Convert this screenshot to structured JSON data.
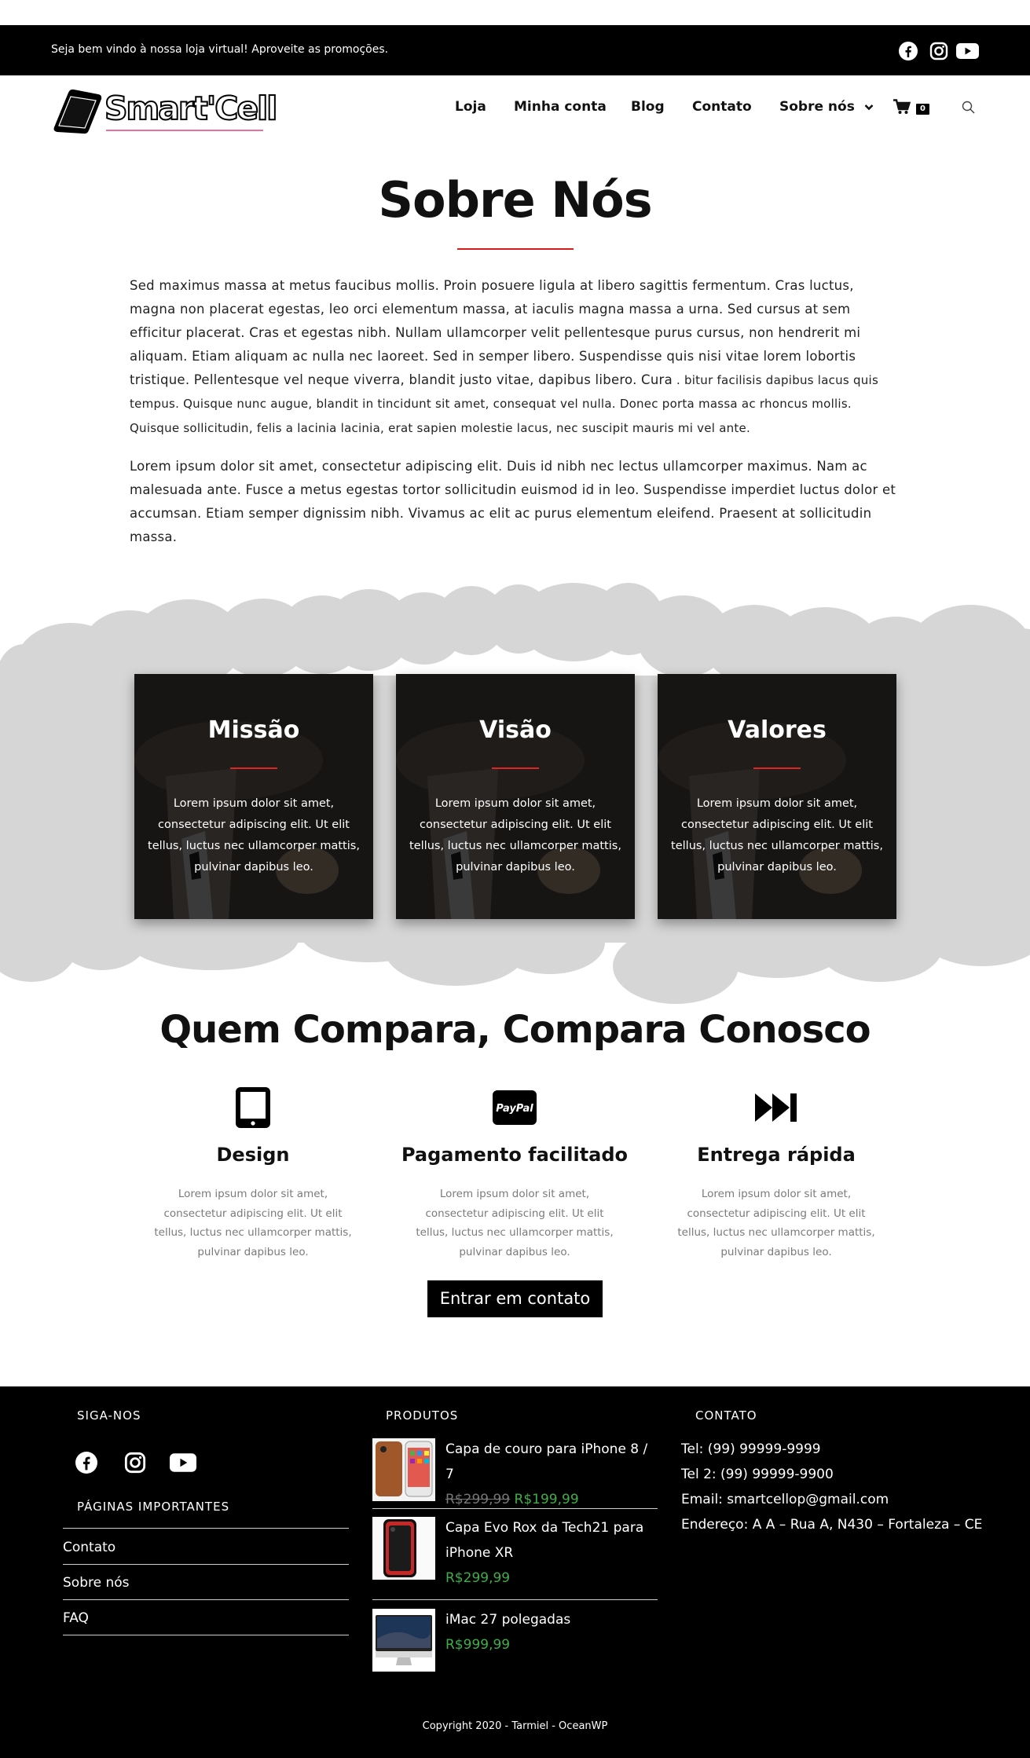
{
  "topbar": {
    "message": "Seja bem vindo à nossa loja virtual! Aproveite as promoções.",
    "social_icons": [
      "facebook-icon",
      "instagram-icon",
      "youtube-icon"
    ]
  },
  "header": {
    "logo_text": "Smart'Cell",
    "nav": [
      "Loja",
      "Minha conta",
      "Blog",
      "Contato",
      "Sobre nós"
    ],
    "cart_count": "0"
  },
  "about": {
    "title": "Sobre Nós",
    "paragraph1": "Sed maximus massa at metus faucibus mollis. Proin posuere ligula at libero sagittis fermentum. Cras luctus, magna non placerat egestas, leo orci elementum massa, at iaculis magna massa a urna. Sed cursus at sem efficitur placerat. Cras et egestas nibh. Nullam ullamcorper velit pellentesque purus cursus, non hendrerit mi aliquam. Etiam aliquam ac nulla nec laoreet. Sed in semper libero. Suspendisse quis nisi vitae lorem lobortis tristique. Pellentesque vel neque viverra, blandit justo vitae, dapibus libero. Cura",
    "paragraph1_small": " . bitur facilisis dapibus lacus quis tempus. Quisque nunc augue, blandit in tincidunt sit amet, consequat vel nulla. Donec porta massa ac rhoncus mollis. Quisque sollicitudin, felis a lacinia lacinia, erat sapien molestie lacus, nec suscipit mauris mi vel ante.",
    "paragraph2": "Lorem ipsum dolor sit amet, consectetur adipiscing elit. Duis id nibh nec lectus ullamcorper maximus. Nam ac malesuada ante. Fusce a metus egestas tortor sollicitudin euismod id in leo. Suspendisse imperdiet luctus dolor et accumsan. Etiam semper dignissim nibh. Vivamus ac elit ac purus elementum eleifend. Praesent at sollicitudin massa."
  },
  "cards": [
    {
      "title": "Missão",
      "text": "Lorem ipsum dolor sit amet, consectetur adipiscing elit. Ut elit tellus, luctus nec ullamcorper mattis, pulvinar dapibus leo."
    },
    {
      "title": "Visão",
      "text": "Lorem ipsum dolor sit amet, consectetur adipiscing elit. Ut elit tellus, luctus nec ullamcorper mattis, pulvinar dapibus leo."
    },
    {
      "title": "Valores",
      "text": "Lorem ipsum dolor sit amet, consectetur adipiscing elit. Ut elit tellus, luctus nec ullamcorper mattis, pulvinar dapibus leo."
    }
  ],
  "compare": {
    "title": "Quem Compara, Compara Conosco",
    "features": [
      {
        "icon": "tablet-icon",
        "title": "Design",
        "text": "Lorem ipsum dolor sit amet, consectetur adipiscing elit. Ut elit tellus, luctus nec ullamcorper mattis, pulvinar dapibus leo."
      },
      {
        "icon": "paypal-icon",
        "icon_text": "PayPal",
        "title": "Pagamento facilitado",
        "text": "Lorem ipsum dolor sit amet, consectetur adipiscing elit. Ut elit tellus, luctus nec ullamcorper mattis, pulvinar dapibus leo."
      },
      {
        "icon": "fast-forward-icon",
        "title": "Entrega rápida",
        "text": "Lorem ipsum dolor sit amet, consectetur adipiscing elit. Ut elit tellus, luctus nec ullamcorper mattis, pulvinar dapibus leo."
      }
    ],
    "cta_label": "Entrar em contato"
  },
  "footer": {
    "follow_heading": "SIGA-NOS",
    "pages_heading": "PÁGINAS IMPORTANTES",
    "pages": [
      "Contato",
      "Sobre nós",
      "FAQ"
    ],
    "products_heading": "PRODUTOS",
    "products": [
      {
        "name_line1": "Capa de couro para iPhone 8 / 7",
        "name_line2": "",
        "old_price": "R$299,99",
        "price": "R$199,99"
      },
      {
        "name_line1": "Capa Evo Rox da Tech21 para",
        "name_line2": "iPhone XR",
        "old_price": "",
        "price": "R$299,99"
      },
      {
        "name_line1": "iMac 27 polegadas",
        "name_line2": "",
        "old_price": "",
        "price": "R$999,99"
      }
    ],
    "contact_heading": "CONTATO",
    "contact": [
      "Tel: (99) 99999-9999",
      "Tel 2: (99) 99999-9900",
      "Email: smartcellop@gmail.com",
      "Endereço: A A – Rua A, N430 – Fortaleza – CE"
    ],
    "copyright": "Copyright 2020 - Tarmiel - OceanWP"
  },
  "colors": {
    "accent_red": "#d81b1b",
    "price_green": "#3fae48",
    "cloud_gray": "#d6d6d6"
  }
}
